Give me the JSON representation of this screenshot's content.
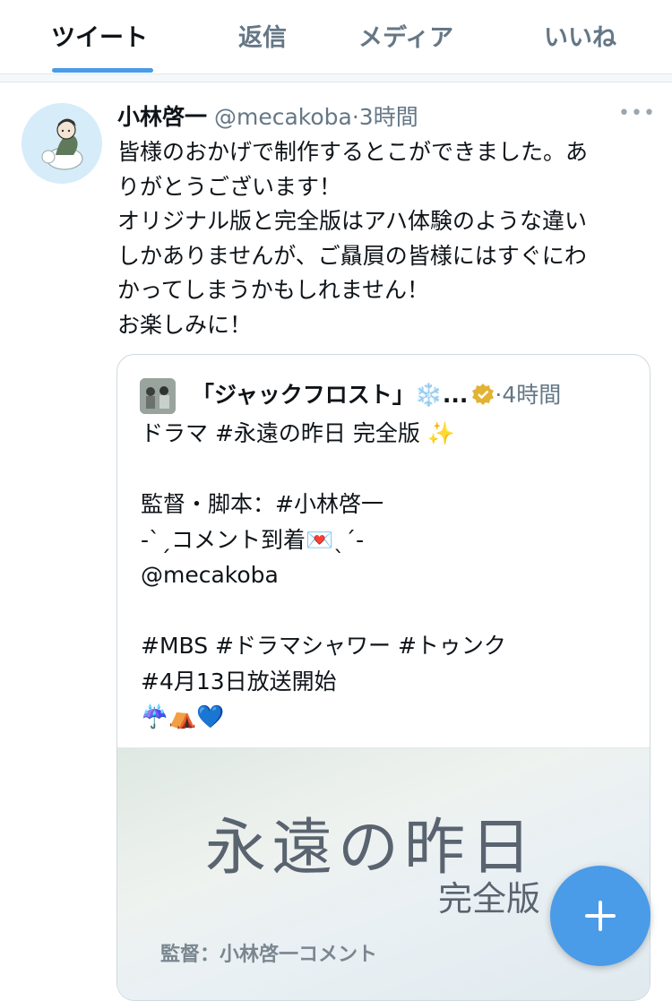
{
  "tabs": [
    {
      "label": "ツイート",
      "active": true
    },
    {
      "label": "返信",
      "active": false
    },
    {
      "label": "メディア",
      "active": false
    },
    {
      "label": "いいね",
      "active": false
    }
  ],
  "tweet": {
    "author_name": "小林啓一",
    "author_handle": "@mecakoba",
    "separator": "·",
    "time": "3時間",
    "more_icon": "more-horizontal-icon",
    "lines": [
      "皆様のおかげで制作するとこができました。あ",
      "りがとうございます！",
      "オリジナル版と完全版はアハ体験のような違い",
      "しかありませんが、ご贔屓の皆様にはすぐにわ",
      "かってしまうかもしれません！",
      "お楽しみに！"
    ]
  },
  "quote": {
    "author_name": "「ジャックフロスト」❄️...",
    "verified_icon": "verified-badge-icon",
    "separator": "·",
    "time": "4時間",
    "lines": [
      "ドラマ #永遠の昨日 完全版 ✨",
      "",
      "監督・脚本：#小林啓一",
      "-`ˏコメント到着💌ˎ´-",
      "@mecakoba",
      "",
      "#MBS #ドラマシャワー #トゥンク",
      "#4月13日放送開始",
      "☔️⛺️💙"
    ],
    "image": {
      "title": "永遠の昨日",
      "subtitle": "完全版",
      "credit": "監督：小林啓一コメント"
    }
  },
  "fab": {
    "icon": "plus-icon"
  },
  "colors": {
    "accent": "#4a9be8",
    "muted": "#657786",
    "border": "#e1e8ed"
  }
}
